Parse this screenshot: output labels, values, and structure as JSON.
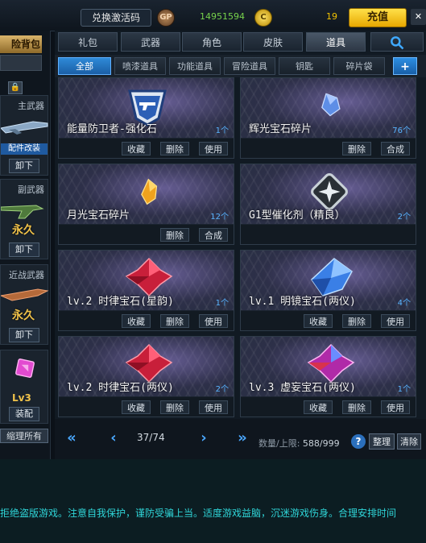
{
  "topbar": {
    "redeem_label": "兑换激活码",
    "gp_icon": "GP",
    "gp_value": "14951594",
    "c_icon": "C",
    "c_value": "19",
    "recharge_label": "充值",
    "close_label": "✕"
  },
  "left_panel": {
    "pack_tab": "险背包",
    "primary": {
      "title": "主武器",
      "badge": "配件改装",
      "unequip": "卸下"
    },
    "secondary": {
      "title": "副武器",
      "forever": "永久",
      "unequip": "卸下"
    },
    "melee": {
      "title": "近战武器",
      "forever": "永久",
      "unequip": "卸下"
    },
    "extra": {
      "level": "Lv3",
      "equip": "装配"
    },
    "organize_all": "缩理所有"
  },
  "category_tabs": [
    "礼包",
    "武器",
    "角色",
    "皮肤",
    "道具"
  ],
  "active_category": "道具",
  "sub_tabs": [
    "全部",
    "喷漆道具",
    "功能道具",
    "冒险道具",
    "钥匙",
    "碎片袋"
  ],
  "active_sub_tab": "全部",
  "plus_label": "+",
  "items": [
    {
      "name": "能量防卫者-强化石",
      "count": "1个",
      "actions": [
        "收藏",
        "删除",
        "使用"
      ],
      "icon": "shield-gun-icon"
    },
    {
      "name": "辉光宝石碎片",
      "count": "76个",
      "actions": [
        "删除",
        "合成"
      ],
      "icon": "blue-crystal-shard-icon"
    },
    {
      "name": "月光宝石碎片",
      "count": "12个",
      "actions": [
        "删除",
        "合成"
      ],
      "icon": "gold-crystal-shard-icon"
    },
    {
      "name": "G1型催化剂（精良）",
      "count": "2个",
      "actions": [],
      "icon": "shuriken-badge-icon"
    },
    {
      "name": "lv.2 时律宝石(星韵)",
      "count": "1个",
      "actions": [
        "收藏",
        "删除",
        "使用"
      ],
      "icon": "red-gem-icon"
    },
    {
      "name": "lv.1 明镜宝石(两仪)",
      "count": "4个",
      "actions": [
        "收藏",
        "删除",
        "使用"
      ],
      "icon": "blue-gem-icon"
    },
    {
      "name": "lv.2 时律宝石(两仪)",
      "count": "2个",
      "actions": [
        "收藏",
        "删除",
        "使用"
      ],
      "icon": "red-gem-icon"
    },
    {
      "name": "lv.3 虚妄宝石(两仪)",
      "count": "1个",
      "actions": [
        "收藏",
        "删除",
        "使用"
      ],
      "icon": "purple-gem-icon"
    }
  ],
  "pager": {
    "first": "«",
    "prev": "‹",
    "page": "37/74",
    "next": "›",
    "last": "»",
    "capacity_label": "数量/上限:",
    "capacity_value": "588/999",
    "help": "?",
    "tidy": "整理",
    "clear": "清除"
  },
  "footer_notice": "拒绝盗版游戏。注意自我保护，谨防受骗上当。适度游戏益脑，沉迷游戏伤身。合理安排时间"
}
